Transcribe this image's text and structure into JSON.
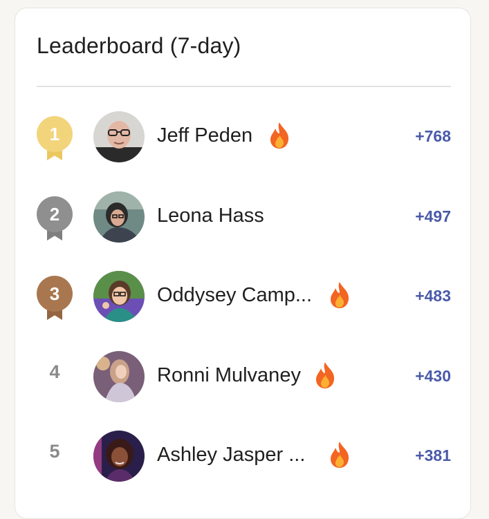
{
  "leaderboard": {
    "title": "Leaderboard (7-day)",
    "colors": {
      "gold": "#f2d47b",
      "silver": "#8f8f8f",
      "bronze": "#a8774f",
      "score": "#4a5aa8"
    },
    "rows": [
      {
        "rank": "1",
        "name": "Jeff Peden",
        "score": "+768",
        "fire": true,
        "medal": "gold",
        "fire_icon": "fire-icon"
      },
      {
        "rank": "2",
        "name": "Leona Hass",
        "score": "+497",
        "fire": false,
        "medal": "silver"
      },
      {
        "rank": "3",
        "name": "Oddysey Camp...",
        "score": "+483",
        "fire": true,
        "medal": "bronze",
        "fire_icon": "fire-icon"
      },
      {
        "rank": "4",
        "name": "Ronni Mulvaney",
        "score": "+430",
        "fire": true,
        "medal": "none",
        "fire_icon": "fire-icon"
      },
      {
        "rank": "5",
        "name": "Ashley Jasper ...",
        "score": "+381",
        "fire": true,
        "medal": "none",
        "fire_icon": "fire-icon"
      }
    ]
  }
}
